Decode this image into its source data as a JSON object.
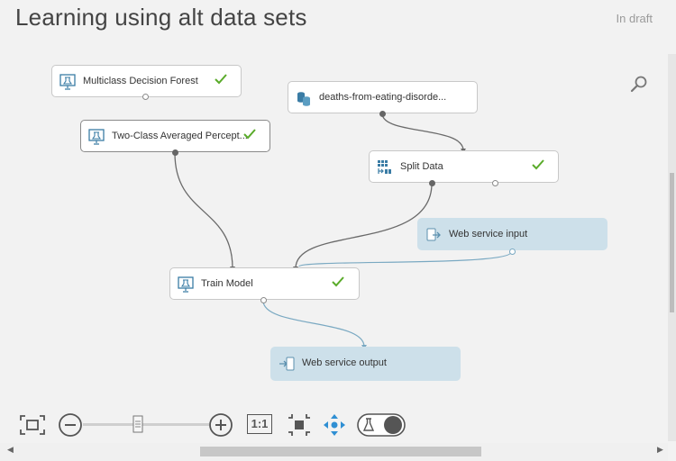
{
  "header": {
    "title": "Learning using alt data sets",
    "status": "In draft"
  },
  "nodes": {
    "multiclass": {
      "label": "Multiclass Decision Forest"
    },
    "twoclass": {
      "label": "Two-Class Averaged Percept..."
    },
    "dataset": {
      "label": "deaths-from-eating-disorde..."
    },
    "split": {
      "label": "Split Data"
    },
    "wsinput": {
      "label": "Web service input"
    },
    "train": {
      "label": "Train Model"
    },
    "wsoutput": {
      "label": "Web service output"
    }
  },
  "toolbar": {
    "actual_size_label": "1:1"
  },
  "colors": {
    "check": "#5aab2a",
    "webservice": "#cde0ea",
    "wire": "#666666",
    "wswire": "#7aa9c2"
  }
}
